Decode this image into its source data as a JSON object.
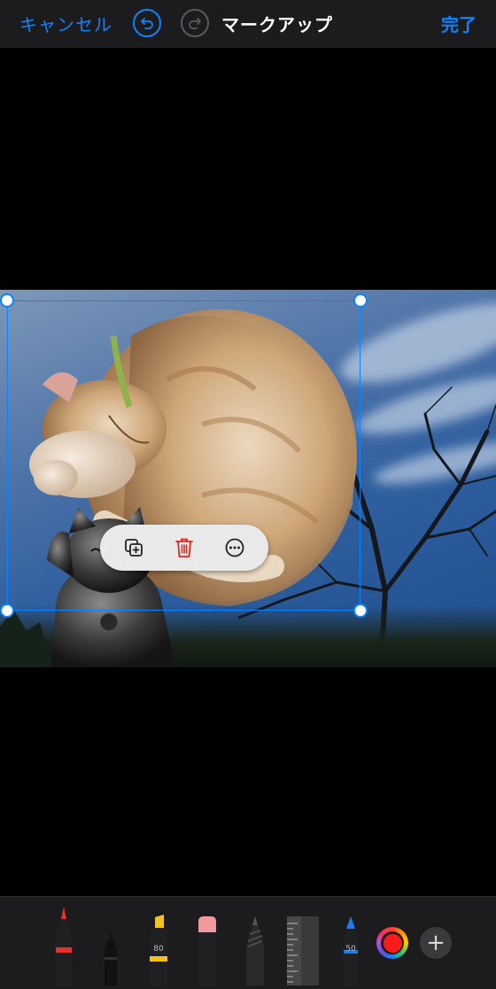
{
  "header": {
    "cancel_label": "キャンセル",
    "title": "マークアップ",
    "done_label": "完了",
    "undo_icon": "undo-icon",
    "redo_icon": "redo-icon"
  },
  "selection_menu": {
    "duplicate_icon": "duplicate-icon",
    "delete_icon": "trash-icon",
    "more_icon": "more-icon"
  },
  "tools": [
    {
      "name": "pen",
      "tip_color": "#e5322c"
    },
    {
      "name": "fineliner",
      "tip_color": "#111111"
    },
    {
      "name": "highlighter",
      "tip_color": "#f7c21a",
      "label": "80"
    },
    {
      "name": "eraser",
      "tip_color": "#f09aa0"
    },
    {
      "name": "pencil",
      "tip_color": "#555555"
    },
    {
      "name": "ruler",
      "tip_color": "#3a3a3c"
    },
    {
      "name": "marker",
      "tip_color": "#1a7cf0",
      "label": "50"
    }
  ],
  "current_color": "#ff1a1a",
  "add_label": "+"
}
